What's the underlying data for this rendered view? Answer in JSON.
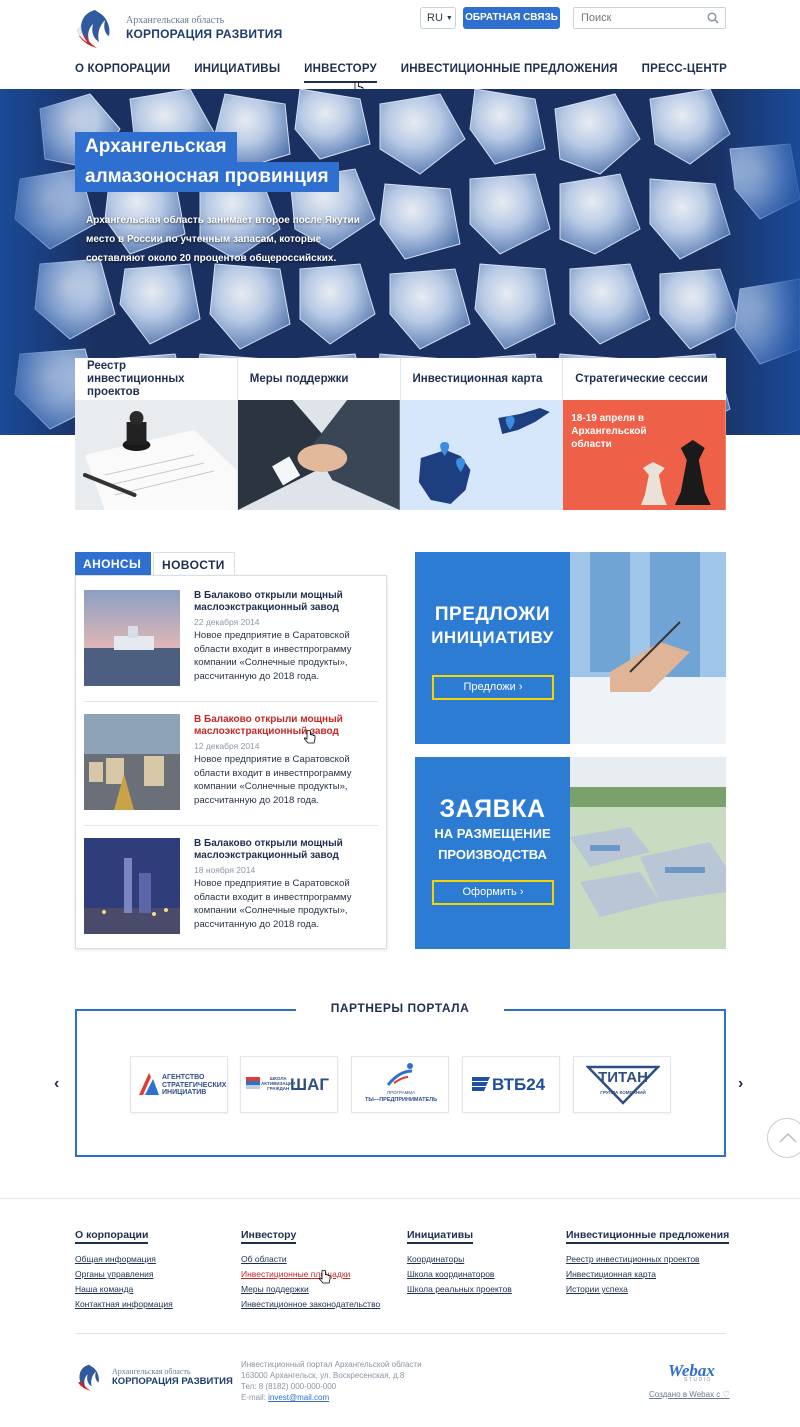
{
  "header": {
    "logo_region": "Архангельская область",
    "logo_corp": "КОРПОРАЦИЯ РАЗВИТИЯ",
    "lang": "RU",
    "feedback_label": "ОБРАТНАЯ СВЯЗЬ",
    "search_placeholder": "Поиск"
  },
  "nav": {
    "items": [
      "О КОРПОРАЦИИ",
      "ИНИЦИАТИВЫ",
      "ИНВЕСТОРУ",
      "ИНВЕСТИЦИОННЫЕ ПРЕДЛОЖЕНИЯ",
      "ПРЕСС-ЦЕНТР"
    ],
    "active": "ИНВЕСТОРУ"
  },
  "hero": {
    "title_line1": "Архангельская",
    "title_line2": "алмазоносная провинция",
    "text": "Архангельская область занимает второе после Якутии место в России по учтенным запасам, которые составляют около 20 процентов общероссийских."
  },
  "tiles": [
    {
      "label": "Реестр инвестиционных проектов"
    },
    {
      "label": "Меры поддержки"
    },
    {
      "label": "Инвестиционная карта"
    },
    {
      "label": "Стратегические сессии",
      "overlay": "18-19 апреля в Архангельской области"
    }
  ],
  "news": {
    "tab_anons": "АНОНСЫ",
    "tab_news": "НОВОСТИ",
    "items": [
      {
        "title": "В Балаково открыли мощный маслоэкстракционный завод",
        "date": "22 декабря 2014",
        "text": "Новое предприятие в Саратовской области входит в инвестпрограмму компании «Солнечные продукты», рассчитанную до 2018 года."
      },
      {
        "title": "В Балаково открыли мощный маслоэкстракционный завод",
        "date": "12 декабря 2014",
        "text": "Новое предприятие в Саратовской области входит в инвестпрограмму компании «Солнечные продукты», рассчитанную до 2018 года."
      },
      {
        "title": "В Балаково открыли мощный маслоэкстракционный завод",
        "date": "18 ноября 2014",
        "text": "Новое предприятие в Саратовской области входит в инвестпрограмму компании «Солнечные продукты», рассчитанную до 2018 года."
      }
    ]
  },
  "promo": {
    "p1_line1": "ПРЕДЛОЖИ",
    "p1_line2": "ИНИЦИАТИВУ",
    "p1_button": "Предложи ›",
    "p2_line1": "ЗАЯВКА",
    "p2_line2": "НА РАЗМЕЩЕНИЕ",
    "p2_line3": "ПРОИЗВОДСТВА",
    "p2_button": "Оформить ›"
  },
  "partners": {
    "title": "ПАРТНЕРЫ ПОРТАЛА",
    "logos": [
      {
        "line1": "АГЕНТСТВО",
        "line2": "СТРАТЕГИЧЕСКИХ",
        "line3": "ИНИЦИАТИВ"
      },
      {
        "small1": "ШКОЛА",
        "small2": "АКТИВИЗАЦИИ",
        "small3": "ГРАЖДАН",
        "big": "ШАГ"
      },
      {
        "small": "ПРОГРАММА",
        "text": "ТЫ—ПРЕДПРИНИМАТЕЛЬ"
      },
      {
        "text": "ВТБ24"
      },
      {
        "text": "ТИТАН",
        "sub": "ГРУППА КОМПАНИЙ"
      }
    ]
  },
  "footer": {
    "cols": [
      {
        "title": "О корпорации",
        "links": [
          "Общая информация",
          "Органы управления",
          "Наша команда",
          "Контактная информация"
        ]
      },
      {
        "title": "Инвестору",
        "links": [
          "Об области",
          "Инвестиционные площадки",
          "Меры поддержки",
          "Инвестиционное законодательство"
        ]
      },
      {
        "title": "Инициативы",
        "links": [
          "Координаторы",
          "Школа координаторов",
          "Школа реальных проектов"
        ]
      },
      {
        "title": "Инвестиционные предложения",
        "links": [
          "Реестр инвестиционных проектов",
          "Инвестиционная карта",
          "Истории успеха"
        ]
      }
    ],
    "logo_region": "Архангельская область",
    "logo_corp": "КОРПОРАЦИЯ РАЗВИТИЯ",
    "contact_line1": "Инвестиционный портал Архангельской области",
    "contact_line2": "163000 Архангельск, ул. Воскресенская, д.8",
    "contact_line3": "Тел: 8 (8182) 000-000-000",
    "contact_email_label": "E-mail:",
    "contact_email": "invest@mail.com",
    "webax": "Webax",
    "webax_sub": "STUDIO",
    "made_by": "Создано в Webax с ♡"
  },
  "colors": {
    "accent": "#2e6fd0",
    "dark": "#1e3050",
    "link_red": "#c62828",
    "btn_border": "#f5d400"
  }
}
